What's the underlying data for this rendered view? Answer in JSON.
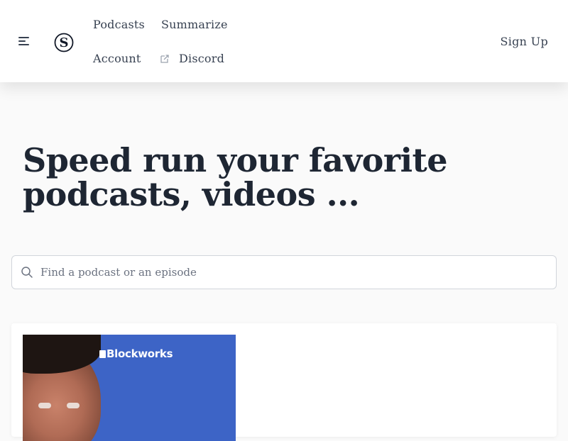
{
  "header": {
    "nav": {
      "podcasts": "Podcasts",
      "summarize": "Summarize",
      "account": "Account",
      "discord": "Discord"
    },
    "signup": "Sign Up",
    "icons": {
      "menu": "hamburger-menu-icon",
      "logo": "s-logo-icon",
      "external": "external-link-icon"
    }
  },
  "hero": {
    "title": "Speed run your favorite podcasts, videos ..."
  },
  "search": {
    "placeholder": "Find a podcast or an episode",
    "value": ""
  },
  "card": {
    "brand": "Blockworks"
  },
  "colors": {
    "thumb_bg": "#3d64c6",
    "text_primary": "#1e2633"
  }
}
